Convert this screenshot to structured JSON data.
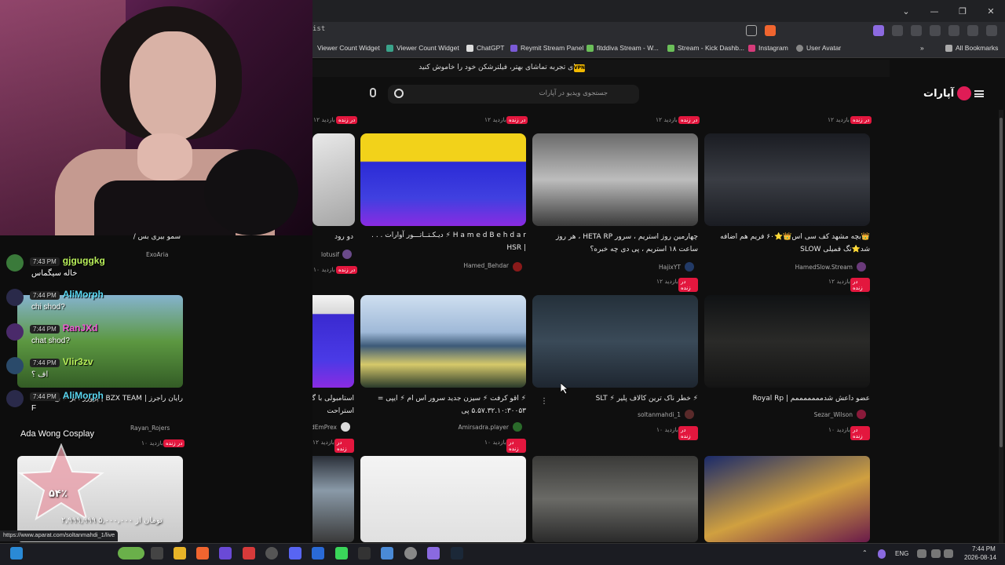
{
  "browser": {
    "url_fragment": "ist",
    "bookmarks": [
      "Viewer Count Widget",
      "Viewer Count Widget",
      "ChatGPT",
      "Reymit Stream Panel",
      "fitddiva Stream - W...",
      "Stream - Kick Dashb...",
      "Instagram",
      "User Avatar"
    ],
    "all_bookmarks": "All Bookmarks",
    "status_url": "https://www.aparat.com/soltanmahdi_1/live"
  },
  "site": {
    "notice": "برای تجربه تماشای بهتر، فیلترشکن خود را خاموش کنید.",
    "vpn": "VPN",
    "search_placeholder": "جستجوی ویدیو در آپارات",
    "logo": "آپارات"
  },
  "top_row": [
    {
      "viewers": "۱۲ بازدید",
      "live": "در زنده"
    },
    {
      "viewers": "۱۲ بازدید",
      "live": "در زنده"
    },
    {
      "viewers": "۱۲ بازدید",
      "live": "در زنده"
    },
    {
      "viewers": "۱۲ بازدید",
      "live": "در زنده"
    }
  ],
  "cards": [
    {
      "title": "دو رود",
      "channel": "lotusif",
      "viewers": "۱۰ بازدید",
      "live": "در زنده"
    },
    {
      "title": "H a m e d B e h d a r ⚡ دیـکـتــاتـــور آوارات . . . | HSR",
      "channel": "Hamed_Behdar",
      "viewers": "",
      "live": ""
    },
    {
      "title": "چهارمین روز استریم ، سرور HETA RP ، هر روز ساعت ۱۸ استریم ، پی دی چه خبره؟",
      "channel": "HajixYT",
      "viewers": "۱۲ بازدید",
      "live": "در زنده"
    },
    {
      "title": "👑بچه مشهد کف سی اس👑⭐۶۰ فریم هم اضافه شد⭐تگ فمیلی SLOW",
      "channel": "HamedSlow.Stream",
      "viewers": "۱۲ بازدید",
      "live": "در زنده"
    },
    {
      "title": "رایان راجرز | BZX TEAM | پرورز ، بر ⚡ بچ",
      "channel": "Rayan_Rojers",
      "viewers": "۱۰ بازدید",
      "live": "در زنده"
    },
    {
      "title": "استامبولی با گربه صورتی - اندلس با تمرین و استراحت",
      "channel": "VahidEmPrex",
      "viewers": "۱۲ بازدید",
      "live": "در زنده"
    },
    {
      "title": "⚡ اقو کرفت ⚡ سیزن جدید سرور اس ام ⚡ ایپی = ۵.۵۷.۳۲.۱۰:۳۰۰۵۳ پی",
      "channel": "Amirsadra.player",
      "viewers": "۱۰ بازدید",
      "live": "در زنده"
    },
    {
      "title": "⚡ خطر ناک ترین کالاف پلیر ⚡ SLT",
      "channel": "soltanmahdi_1",
      "viewers": "۱۰ بازدید",
      "live": "در زنده"
    },
    {
      "title": "عضو داعش شدمممممممم | Royal Rp",
      "channel": "Sezar_Wilson",
      "viewers": "۱۰ بازدید",
      "live": "در زنده"
    }
  ],
  "first_card_channel_top": "ExoAria",
  "first_card_title_top": "سمو بیری بس /",
  "chat": [
    {
      "time": "7:43 PM",
      "user": "gjguggkg",
      "msg": "خاله سیگماس"
    },
    {
      "time": "7:44 PM",
      "user": "AliMorph",
      "msg": "chi shod?"
    },
    {
      "time": "7:44 PM",
      "user": "RanJXd",
      "msg": "chat shod?"
    },
    {
      "time": "7:44 PM",
      "user": "Vlir3zv",
      "msg": "اف ؟"
    },
    {
      "time": "7:44 PM",
      "user": "AliMorph",
      "msg": "F"
    }
  ],
  "overlay": {
    "tag": "Ada Wong Cosplay",
    "percent": "۵۴٪",
    "coins": "۲,۹۹۹,۹۹۹ تومان از ۵,۰۰۰,۰۰۰"
  },
  "taskbar": {
    "lang": "ENG",
    "time": "7:44 PM",
    "date": "2026-08-14"
  },
  "colors": {
    "accent": "#df1c56",
    "live": "#e3173e"
  }
}
